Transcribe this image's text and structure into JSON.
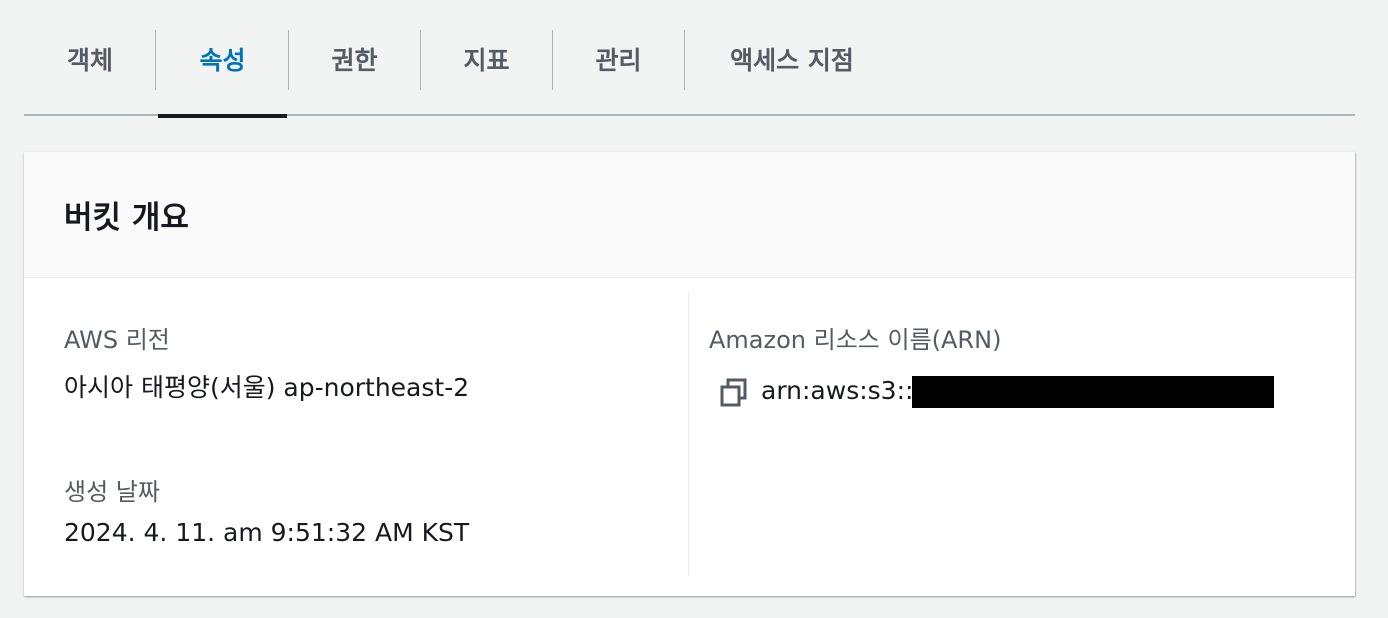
{
  "tabs": [
    {
      "label": "객체",
      "active": false
    },
    {
      "label": "속성",
      "active": true
    },
    {
      "label": "권한",
      "active": false
    },
    {
      "label": "지표",
      "active": false
    },
    {
      "label": "관리",
      "active": false
    },
    {
      "label": "액세스 지점",
      "active": false
    }
  ],
  "overview": {
    "title": "버킷 개요",
    "region_label": "AWS 리전",
    "region_value": "아시아 태평양(서울) ap-northeast-2",
    "created_label": "생성 날짜",
    "created_value": "2024. 4. 11. am 9:51:32 AM KST",
    "arn_label": "Amazon 리소스 이름(ARN)",
    "arn_value": "arn:aws:s3:::",
    "arn_icon": "copy-icon"
  },
  "colors": {
    "accent": "#0073bb",
    "text": "#16191f",
    "muted": "#545b64",
    "background": "#f2f3f3"
  }
}
